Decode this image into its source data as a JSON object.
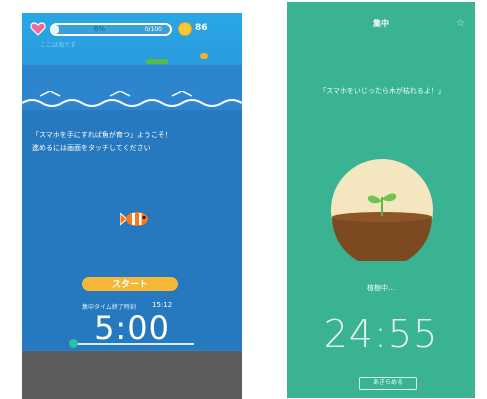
{
  "left_app": {
    "hp_percent_text": "6%",
    "hp_right_text": "0/100",
    "hp_value": 0.06,
    "coin_count": "86",
    "status_subtext": "ここは海です",
    "welcome_message_line1": "「スマホを手にすれば魚が育つ」ようこそ！",
    "welcome_message_line2": "進めるには画面をタッチしてください",
    "start_button": "スタート",
    "timer_label": "集中タイム終了時刻",
    "timer_end": "15:12",
    "timer_display": "5:00",
    "colors": {
      "sky": "#29a7e6",
      "sea": "#2679be",
      "button": "#f6b636",
      "knob": "#29c1a1",
      "ground": "#5c5c5c"
    },
    "icons": [
      "heart-icon",
      "coin-icon",
      "fish-icon",
      "wave-icon"
    ]
  },
  "right_app": {
    "title": "集中",
    "corner_icon": "☆",
    "quote": "「スマホをいじったら木が枯れるよ！」",
    "status_text": "植樹中…",
    "timer_display": "24:55",
    "give_up_button": "あきらめる",
    "colors": {
      "background": "#39b392",
      "circle": "#f4e7c0",
      "soil": "#7b4a21",
      "sprout": "#6ac64f"
    },
    "icons": [
      "sprout-icon",
      "settings-icon"
    ]
  }
}
